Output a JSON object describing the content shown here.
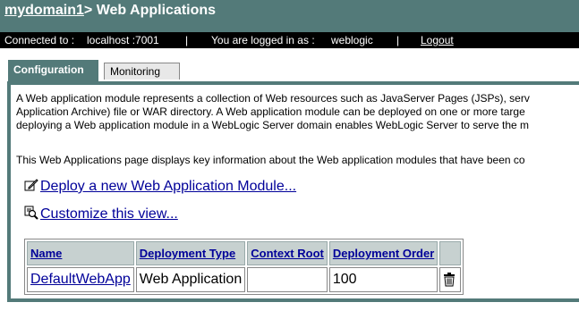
{
  "header": {
    "domain_link": "mydomain1",
    "separator": ">",
    "page_title": "Web Applications"
  },
  "status": {
    "connected_label": "Connected to :",
    "connected_host": "localhost :7001",
    "divider": "|",
    "logged_in_label": "You are logged in as :",
    "user": "weblogic",
    "logout": "Logout"
  },
  "tabs": [
    {
      "label": "Configuration",
      "active": true
    },
    {
      "label": "Monitoring",
      "active": false
    }
  ],
  "description": {
    "line1": "A Web application module represents a collection of Web resources such as JavaServer Pages (JSPs), serv",
    "line2": "Application Archive) file or WAR directory. A Web application module can be deployed on one or more targe",
    "line3": "deploying a Web application module in a WebLogic Server domain enables WebLogic Server to serve the m",
    "line4": "This Web Applications page displays key information about the Web application modules that have been co"
  },
  "actions": {
    "deploy": "Deploy a new Web Application Module...",
    "customize": "Customize this view..."
  },
  "table": {
    "columns": [
      "Name",
      "Deployment Type",
      "Context Root",
      "Deployment Order"
    ],
    "rows": [
      {
        "name": "DefaultWebApp",
        "type": "Web Application",
        "context_root": "",
        "order": "100"
      }
    ]
  },
  "icons": {
    "deploy": "edit-pencil-icon",
    "customize": "magnifier-icon",
    "delete": "trash-icon"
  },
  "colors": {
    "header_bg": "#537A79",
    "status_bg": "#000000",
    "link": "#000099",
    "table_header_bg": "#C7D1D0"
  }
}
